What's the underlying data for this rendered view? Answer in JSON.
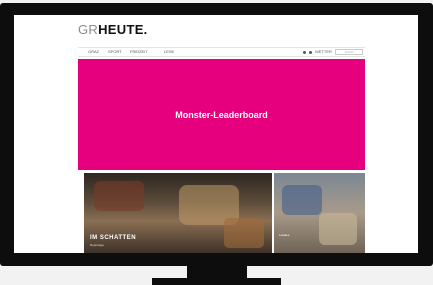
{
  "site": {
    "logo_prefix": "GR",
    "logo_main": "HEUTE",
    "logo_dot": "."
  },
  "nav": {
    "items": [
      "GRAZ",
      "SPORT",
      "FREIZEIT",
      "LESE"
    ],
    "weather": "WETTER",
    "search_placeholder": "Suche"
  },
  "ad": {
    "label": "Monster-Leaderboard",
    "color": "#e6007e"
  },
  "tiles": {
    "main_title": "IM SCHATTEN",
    "main_sub": "Reportage",
    "side_caption": "Lokales"
  }
}
